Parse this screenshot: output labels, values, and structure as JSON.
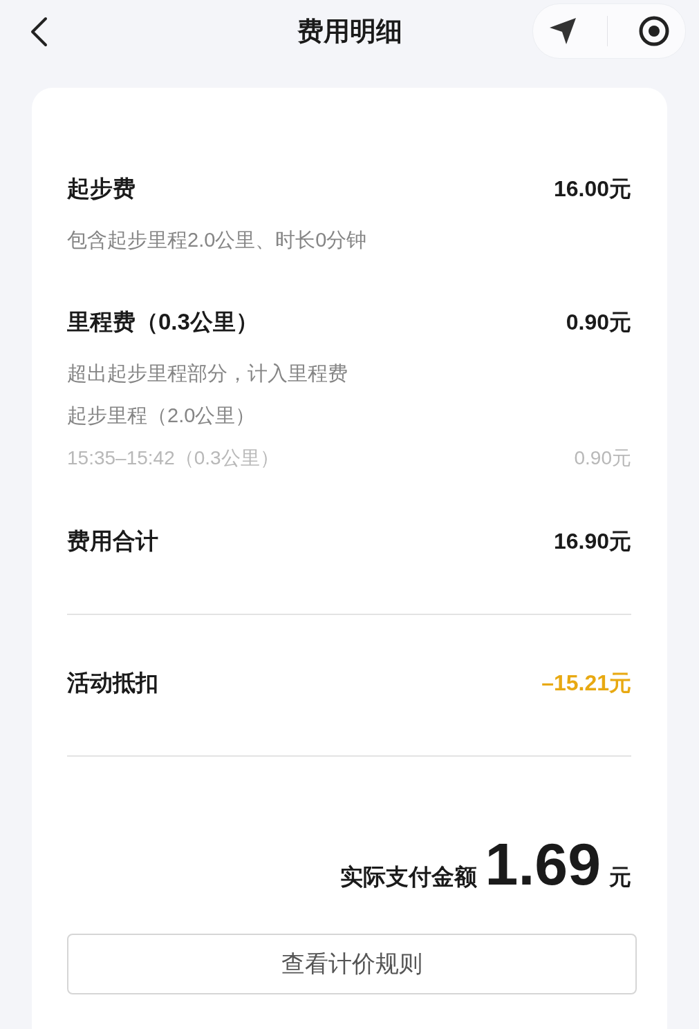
{
  "header": {
    "title": "费用明细"
  },
  "fees": [
    {
      "label": "起步费",
      "amount": "16.00元",
      "notes": [
        "包含起步里程2.0公里、时长0分钟"
      ]
    },
    {
      "label": "里程费（0.3公里）",
      "amount": "0.90元",
      "notes": [
        "超出起步里程部分，计入里程费",
        "起步里程（2.0公里）"
      ],
      "details": [
        {
          "label": "15:35–15:42（0.3公里）",
          "amount": "0.90元"
        }
      ]
    }
  ],
  "summary": [
    {
      "kind": "total",
      "label": "费用合计",
      "amount": "16.90元"
    },
    {
      "kind": "discount",
      "label": "活动抵扣",
      "amount": "–15.21元"
    }
  ],
  "payment": {
    "label": "实际支付金额",
    "amount": "1.69",
    "unit": "元"
  },
  "rule_button": "查看计价规则"
}
